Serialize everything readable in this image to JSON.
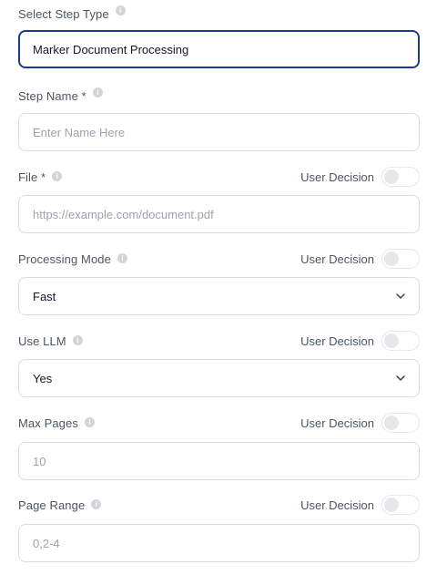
{
  "step_type": {
    "label": "Select Step Type",
    "value": "Marker Document Processing"
  },
  "step_name": {
    "label": "Step Name *",
    "placeholder": "Enter Name Here"
  },
  "file": {
    "label": "File *",
    "placeholder": "https://example.com/document.pdf",
    "decision_label": "User Decision"
  },
  "processing_mode": {
    "label": "Processing Mode",
    "value": "Fast",
    "decision_label": "User Decision"
  },
  "use_llm": {
    "label": "Use LLM",
    "value": "Yes",
    "decision_label": "User Decision"
  },
  "max_pages": {
    "label": "Max Pages",
    "placeholder": "10",
    "decision_label": "User Decision"
  },
  "page_range": {
    "label": "Page Range",
    "placeholder": "0,2-4",
    "decision_label": "User Decision"
  },
  "icons": {
    "info": "info-icon",
    "chevron": "chevron-down-icon"
  },
  "colors": {
    "focus_border": "#1e3a8a",
    "border": "#d9dde3",
    "toggle_off": "#e5e7eb"
  }
}
